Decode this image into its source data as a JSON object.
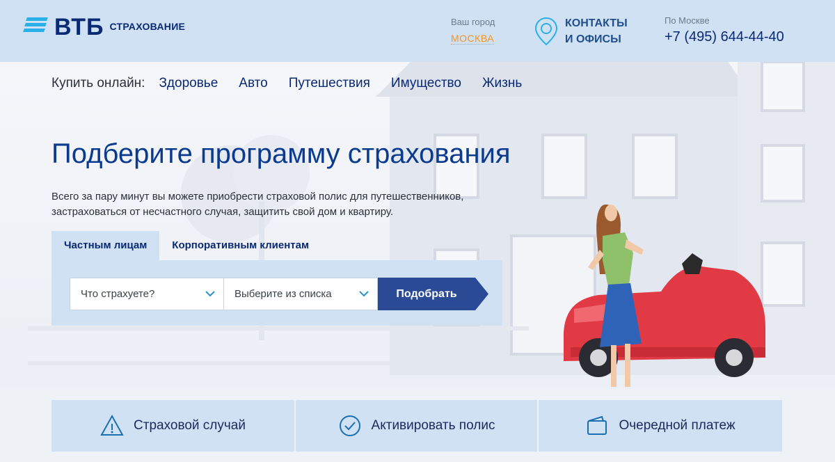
{
  "header": {
    "logo_text": "ВТБ",
    "logo_sub": "СТРАХОВАНИЕ",
    "city_label": "Ваш город",
    "city_value": "МОСКВА",
    "contacts_line1": "КОНТАКТЫ",
    "contacts_line2": "И ОФИСЫ",
    "phone_label": "По Москве",
    "phone_value": "+7 (495) 644-44-40"
  },
  "nav": {
    "label": "Купить онлайн:",
    "items": [
      "Здоровье",
      "Авто",
      "Путешествия",
      "Имущество",
      "Жизнь"
    ]
  },
  "hero": {
    "title": "Подберите программу страхования",
    "desc_line1": "Всего за пару минут вы можете приобрести страховой полис для путешественников,",
    "desc_line2": "застраховаться от несчастного случая, защитить свой дом и квартиру."
  },
  "tabs": [
    "Частным лицам",
    "Корпоративным клиентам"
  ],
  "form": {
    "select1": "Что страхуете?",
    "select2": "Выберите из списка",
    "submit": "Подобрать"
  },
  "actions": [
    "Страховой случай",
    "Активировать полис",
    "Очередной платеж"
  ],
  "colors": {
    "brand": "#0a2973",
    "accent": "#f7941e",
    "panel": "#cfe1f3",
    "button": "#2b4a96"
  }
}
